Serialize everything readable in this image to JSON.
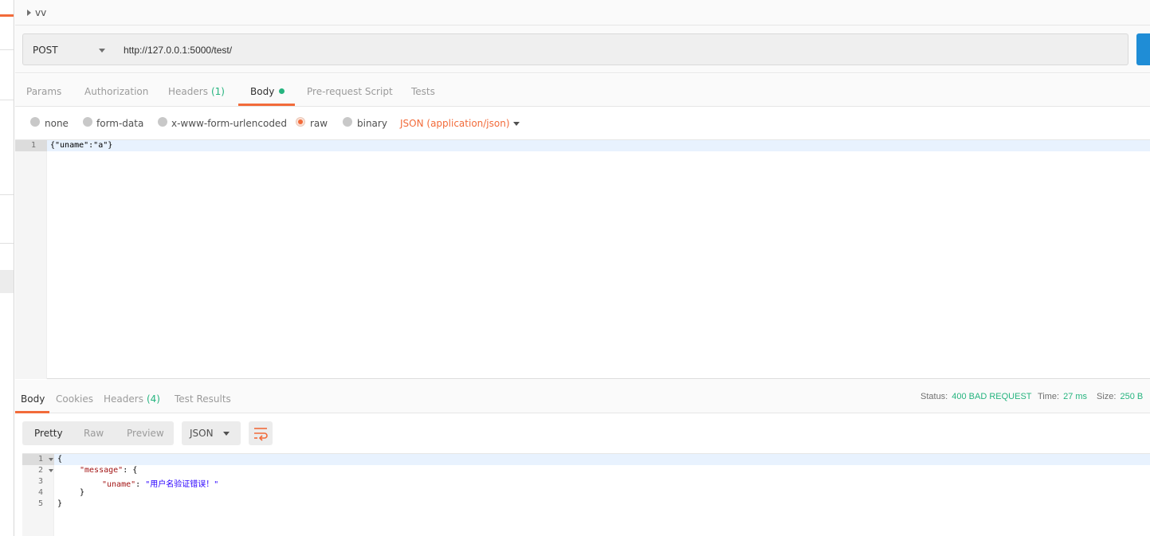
{
  "request": {
    "name": "vv",
    "method": "POST",
    "url": "http://127.0.0.1:5000/test/"
  },
  "request_tabs": [
    {
      "label": "Params",
      "count": ""
    },
    {
      "label": "Authorization",
      "count": ""
    },
    {
      "label": "Headers",
      "count": "(1)"
    },
    {
      "label": "Body",
      "count": ""
    },
    {
      "label": "Pre-request Script",
      "count": ""
    },
    {
      "label": "Tests",
      "count": ""
    }
  ],
  "body_options": {
    "none": "none",
    "form_data": "form-data",
    "urlencoded": "x-www-form-urlencoded",
    "raw": "raw",
    "binary": "binary",
    "selected": "raw",
    "content_type": "JSON (application/json)"
  },
  "request_body": {
    "line_numbers": [
      "1"
    ],
    "lines": [
      "{\"uname\":\"a\"}"
    ]
  },
  "response_tabs": [
    {
      "label": "Body",
      "count": ""
    },
    {
      "label": "Cookies",
      "count": ""
    },
    {
      "label": "Headers",
      "count": "(4)"
    },
    {
      "label": "Test Results",
      "count": ""
    }
  ],
  "response_meta": {
    "status_label": "Status:",
    "status_value": "400 BAD REQUEST",
    "time_label": "Time:",
    "time_value": "27 ms",
    "size_label": "Size:",
    "size_value": "250 B"
  },
  "response_view": {
    "modes": [
      "Pretty",
      "Raw",
      "Preview"
    ],
    "active_mode": "Pretty",
    "format": "JSON"
  },
  "response_body": {
    "line_numbers": [
      "1",
      "2",
      "3",
      "4",
      "5"
    ],
    "open_brace": "{",
    "message_key": "\"message\"",
    "uname_key": "\"uname\"",
    "uname_value": "\"用户名验证错误！\"",
    "inner_close": "}",
    "close_brace": "}"
  },
  "colors": {
    "accent": "#f26b3a",
    "success": "#26b47f",
    "send": "#1f8dd6"
  }
}
